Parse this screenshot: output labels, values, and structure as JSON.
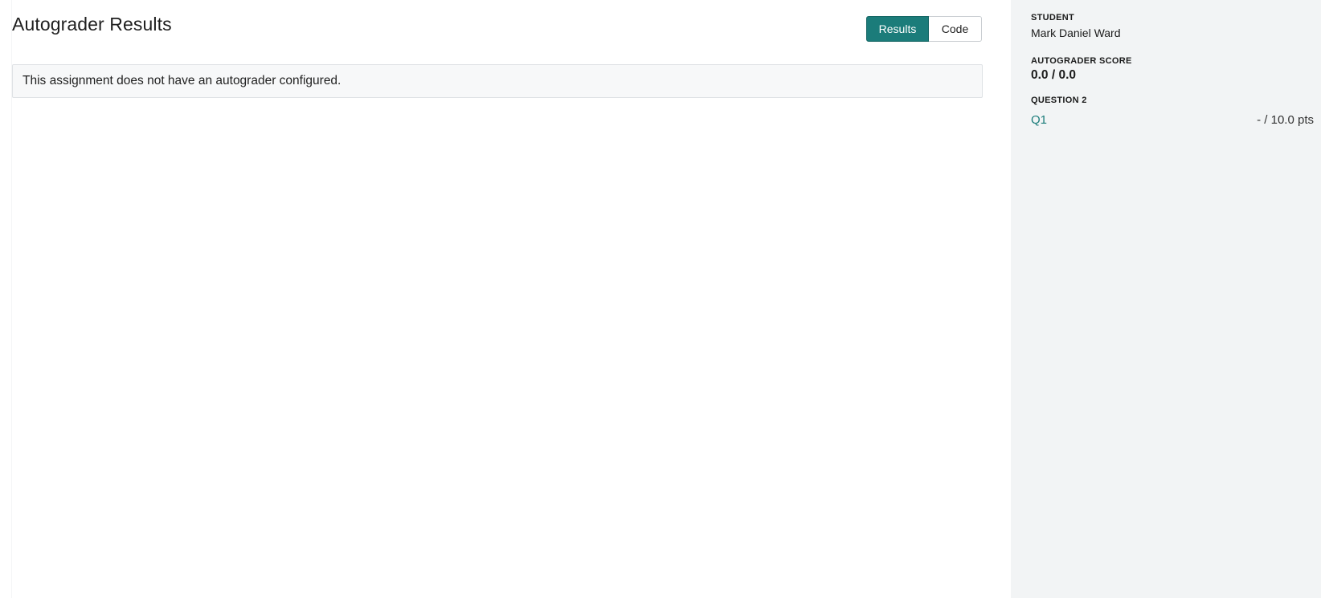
{
  "main": {
    "title": "Autograder Results",
    "toggle": {
      "results_label": "Results",
      "code_label": "Code"
    },
    "notice": "This assignment does not have an autograder configured."
  },
  "sidebar": {
    "student_label": "STUDENT",
    "student_name": "Mark Daniel Ward",
    "score_label": "AUTOGRADER SCORE",
    "score_value": "0.0 / 0.0",
    "question_label": "QUESTION 2",
    "question_link": "Q1",
    "question_points": "- / 10.0 pts"
  },
  "colors": {
    "accent": "#1b7c7a",
    "sidebar_bg": "#f2f4f5",
    "notice_bg": "#f7f8f9"
  }
}
